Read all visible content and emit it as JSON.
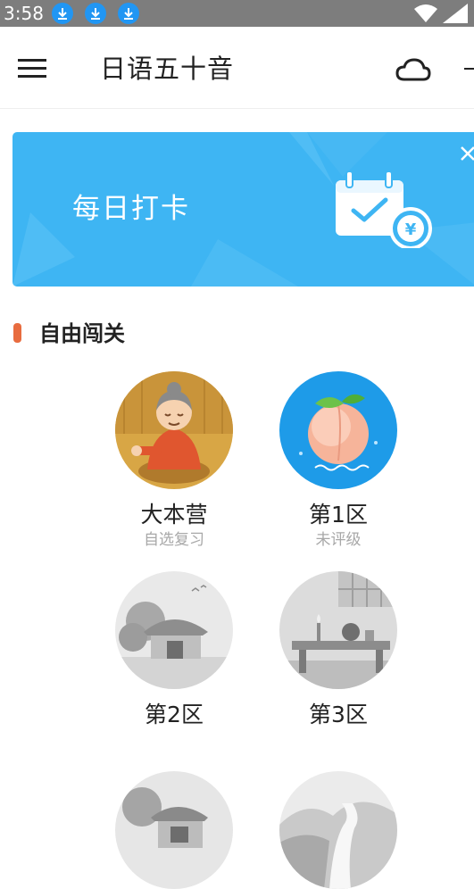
{
  "status_bar": {
    "time": "3:58"
  },
  "app_bar": {
    "title": "日语五十音",
    "menu_icon": "menu-icon",
    "cloud_icon": "cloud-icon"
  },
  "banner": {
    "text": "每日打卡",
    "icon": "calendar-check-icon"
  },
  "section": {
    "title": "自由闯关"
  },
  "levels": [
    {
      "name": "大本营",
      "sub": "自选复习",
      "image": "grandma-illustration"
    },
    {
      "name": "第1区",
      "sub": "未评级",
      "image": "peach-illustration"
    },
    {
      "name": "第2区",
      "sub": "",
      "image": "house-illustration"
    },
    {
      "name": "第3区",
      "sub": "",
      "image": "table-illustration"
    },
    {
      "name": "",
      "sub": "",
      "image": "village-illustration"
    },
    {
      "name": "",
      "sub": "",
      "image": "river-illustration"
    }
  ],
  "colors": {
    "banner": "#3eb5f3",
    "section_accent": "#e86c3f",
    "status_bar": "#7d7d7d",
    "download_badge": "#2196f3"
  }
}
